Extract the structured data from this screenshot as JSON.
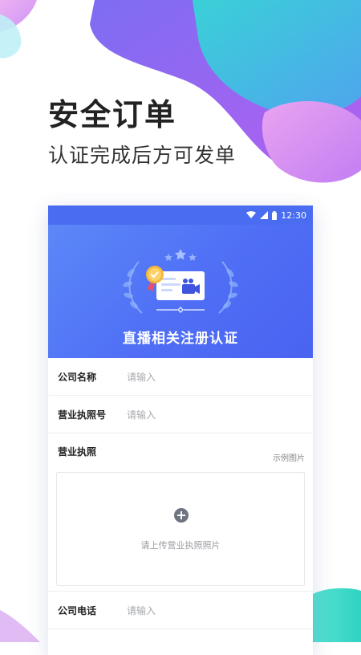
{
  "hero": {
    "title": "安全订单",
    "subtitle": "认证完成后方可发单"
  },
  "status_bar": {
    "time": "12:30",
    "icons": [
      "wifi-icon",
      "signal-icon",
      "battery-icon"
    ]
  },
  "banner": {
    "title": "直播相关注册认证",
    "illustration": "certificate-video-icon"
  },
  "form": {
    "company_name": {
      "label": "公司名称",
      "placeholder": "请输入"
    },
    "license_number": {
      "label": "营业执照号",
      "placeholder": "请输入"
    },
    "license_upload": {
      "label": "营业执照",
      "sample_link": "示例图片",
      "hint": "请上传营业执照照片",
      "icon": "plus-circle-icon"
    },
    "company_phone": {
      "label": "公司电话",
      "placeholder": "请输入"
    }
  },
  "colors": {
    "primary": "#4f6ef5",
    "blob_purple": "#9a5cf0",
    "blob_cyan": "#45d3d8"
  }
}
